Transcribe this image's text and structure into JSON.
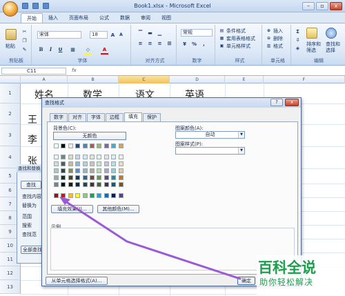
{
  "window": {
    "title": "Book1.xlsx - Microsoft Excel",
    "help": "?",
    "close": "x",
    "min": "–",
    "max": "▫"
  },
  "ribbon_tabs": [
    "开始",
    "插入",
    "页面布局",
    "公式",
    "数据",
    "审阅",
    "视图"
  ],
  "ribbon": {
    "paste": "粘贴",
    "clipboard": "剪贴板",
    "font_name": "宋体",
    "font_size": "18",
    "font": "字体",
    "align": "对齐方式",
    "number_format": "常规",
    "number": "数字",
    "cond_format": "条件格式",
    "table_format": "套用表格格式",
    "cell_style": "单元格样式",
    "style": "样式",
    "insert": "插入",
    "delete": "删除",
    "format": "格式",
    "cells": "单元格",
    "sort": "排序和",
    "sort2": "筛选",
    "find": "查找和",
    "find2": "选择",
    "edit": "编辑"
  },
  "formula_bar": {
    "name_box": "C11",
    "fx": "fx"
  },
  "columns": [
    "A",
    "B",
    "C",
    "D",
    "E",
    "F"
  ],
  "rows": [
    "1",
    "2",
    "3",
    "4",
    "5",
    "6",
    "7",
    "8",
    "9",
    "10",
    "11",
    "12",
    "13"
  ],
  "cells": {
    "a1": "姓名",
    "b1": "数学",
    "c1": "语文",
    "d1": "英语",
    "a2": "王",
    "a3": "李",
    "a4": "张"
  },
  "find_dialog": {
    "title": "查找和替换",
    "find": "查找",
    "find_what": "查找内容",
    "replace_with": "替换为",
    "within": "范围",
    "search": "搜索",
    "look_in": "查找范",
    "find_all": "全部查找"
  },
  "format_dialog": {
    "title": "查找格式",
    "tabs": [
      "数字",
      "对齐",
      "字体",
      "边框",
      "填充",
      "保护"
    ],
    "bg_label": "背景色(C):",
    "no_color": "无颜色",
    "pattern_color_label": "图案颜色(A):",
    "pattern_color_value": "自动",
    "pattern_style_label": "图案样式(P):",
    "fill_effects": "填充效果(I)...",
    "more_colors": "其他颜色(M)...",
    "sample": "示例",
    "from_cell": "从单元格选择格式(A)...",
    "ok": "确定"
  },
  "watermark": {
    "logo": "百科全说",
    "sub": "助你轻松解决"
  },
  "colors": {
    "accent": "#1aa04a",
    "arrow": "#9b59d6",
    "theme_row": [
      "#ffffff",
      "#000000",
      "#eeece1",
      "#1f497d",
      "#4f81bd",
      "#c0504d",
      "#9bbb59",
      "#8064a2",
      "#4bacc6",
      "#f79646"
    ],
    "tint1": [
      "#f2f2f2",
      "#7f7f7f",
      "#ddd9c3",
      "#c6d9f0",
      "#dbe5f1",
      "#f2dcdb",
      "#ebf1dd",
      "#e5e0ec",
      "#dbeef3",
      "#fdeada"
    ],
    "tint2": [
      "#d8d8d8",
      "#595959",
      "#c4bd97",
      "#8db3e2",
      "#b8cce4",
      "#e5b9b7",
      "#d7e3bc",
      "#ccc1d9",
      "#b7dde8",
      "#fbd5b5"
    ],
    "tint3": [
      "#bfbfbf",
      "#3f3f3f",
      "#938953",
      "#548dd4",
      "#95b3d7",
      "#d99694",
      "#c3d69b",
      "#b2a2c7",
      "#92cddc",
      "#fac08f"
    ],
    "tint4": [
      "#a5a5a5",
      "#262626",
      "#494429",
      "#17365d",
      "#366092",
      "#953734",
      "#76923c",
      "#5f497a",
      "#31859b",
      "#e36c09"
    ],
    "tint5": [
      "#7f7f7f",
      "#0c0c0c",
      "#1d1b10",
      "#0f243e",
      "#244061",
      "#632423",
      "#4f6128",
      "#3f3151",
      "#205867",
      "#974806"
    ],
    "standard": [
      "#c00000",
      "#ff0000",
      "#ffc000",
      "#ffff00",
      "#92d050",
      "#00b050",
      "#00b0f0",
      "#0070c0",
      "#002060",
      "#7030a0"
    ]
  }
}
